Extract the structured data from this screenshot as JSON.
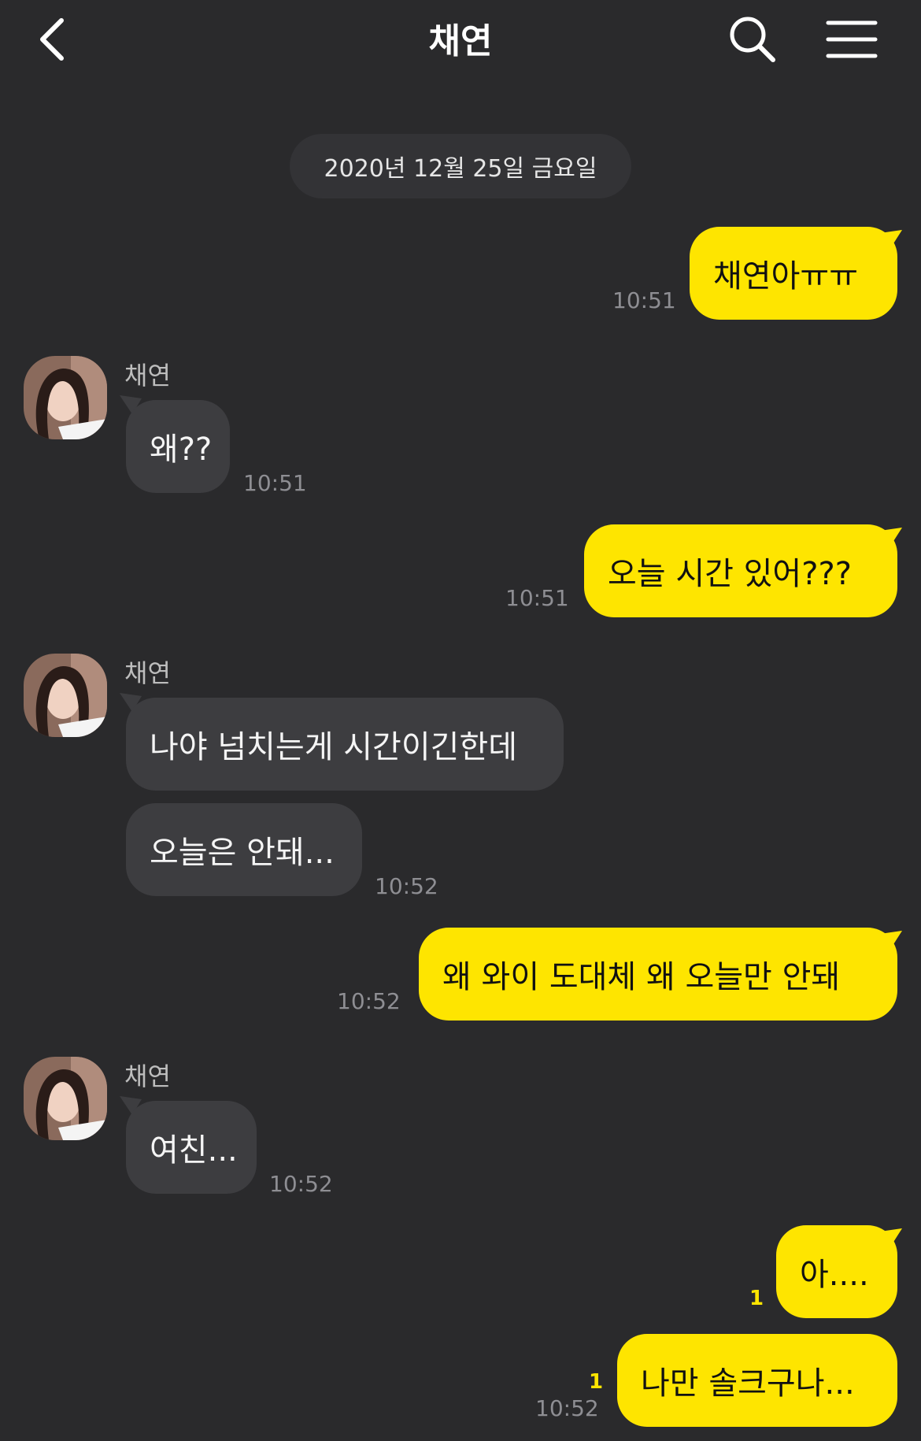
{
  "header": {
    "title": "채연",
    "back_icon": "chevron-left-icon",
    "search_icon": "search-icon",
    "menu_icon": "hamburger-menu-icon"
  },
  "date_divider": "2020년 12월 25일 금요일",
  "colors": {
    "background": "#2a2a2c",
    "my_bubble": "#fee500",
    "their_bubble": "#3d3d40",
    "unread": "#fee500"
  },
  "messages": [
    {
      "from": "me",
      "text": "채연아ㅠㅠ",
      "time": "10:51"
    },
    {
      "from": "them",
      "sender": "채연",
      "text": "왜??",
      "time": "10:51"
    },
    {
      "from": "me",
      "text": "오늘 시간 있어???",
      "time": "10:51"
    },
    {
      "from": "them",
      "sender": "채연",
      "text": "나야 넘치는게 시간이긴한데"
    },
    {
      "from": "them",
      "text": "오늘은 안돼...",
      "time": "10:52"
    },
    {
      "from": "me",
      "text": "왜 와이 도대체 왜 오늘만 안돼",
      "time": "10:52"
    },
    {
      "from": "them",
      "sender": "채연",
      "text": "여친...",
      "time": "10:52"
    },
    {
      "from": "me",
      "text": "아....",
      "unread": "1"
    },
    {
      "from": "me",
      "text": "나만 솔크구나...",
      "unread": "1",
      "time": "10:52"
    }
  ]
}
